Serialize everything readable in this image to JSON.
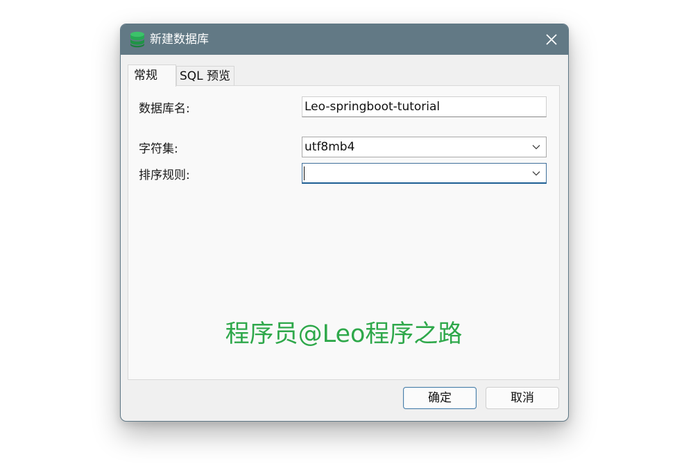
{
  "window": {
    "title": "新建数据库",
    "icon": "database-icon",
    "close_icon": "close-icon",
    "accent": "#627985"
  },
  "tabs": [
    {
      "label": "常规",
      "active": true
    },
    {
      "label": "SQL 预览",
      "active": false
    }
  ],
  "form": {
    "name_label": "数据库名:",
    "name_value": "Leo-springboot-tutorial",
    "charset_label": "字符集:",
    "charset_value": "utf8mb4",
    "collation_label": "排序规则:",
    "collation_value": ""
  },
  "watermark": {
    "text": "程序员@Leo程序之路",
    "color": "#2ea84a"
  },
  "buttons": {
    "ok_label": "确定",
    "cancel_label": "取消"
  }
}
